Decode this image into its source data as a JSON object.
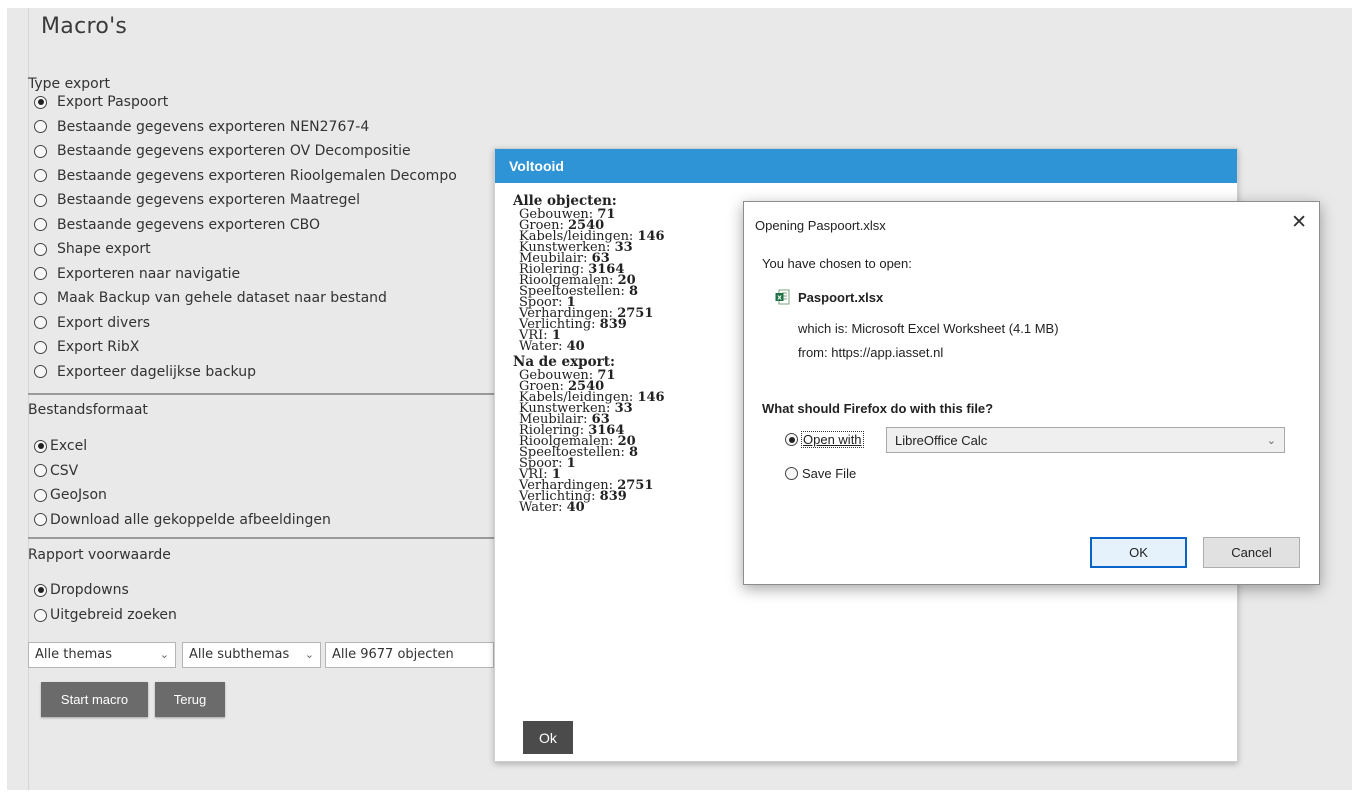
{
  "page": {
    "title": "Macro's"
  },
  "type_export": {
    "label": "Type export",
    "options": [
      {
        "label": "Export Paspoort",
        "checked": true
      },
      {
        "label": "Bestaande gegevens exporteren NEN2767-4",
        "checked": false
      },
      {
        "label": "Bestaande gegevens exporteren OV Decompositie",
        "checked": false
      },
      {
        "label": "Bestaande gegevens exporteren Rioolgemalen Decompo",
        "checked": false
      },
      {
        "label": "Bestaande gegevens exporteren Maatregel",
        "checked": false
      },
      {
        "label": "Bestaande gegevens exporteren CBO",
        "checked": false
      },
      {
        "label": "Shape export",
        "checked": false
      },
      {
        "label": "Exporteren naar navigatie",
        "checked": false
      },
      {
        "label": "Maak Backup van gehele dataset naar bestand",
        "checked": false
      },
      {
        "label": "Export divers",
        "checked": false
      },
      {
        "label": "Export RibX",
        "checked": false
      },
      {
        "label": "Exporteer dagelijkse backup",
        "checked": false
      }
    ]
  },
  "bestandsformaat": {
    "label": "Bestandsformaat",
    "options": [
      {
        "label": "Excel",
        "checked": true
      },
      {
        "label": "CSV",
        "checked": false
      },
      {
        "label": "GeoJson",
        "checked": false
      },
      {
        "label": "Download alle gekoppelde afbeeldingen",
        "checked": false
      }
    ]
  },
  "rapport_voorwaarde": {
    "label": "Rapport voorwaarde",
    "options": [
      {
        "label": "Dropdowns",
        "checked": true
      },
      {
        "label": "Uitgebreid zoeken",
        "checked": false
      }
    ]
  },
  "filters": {
    "themas": "Alle themas",
    "subthemas": "Alle subthemas",
    "objecten": "Alle 9677 objecten"
  },
  "buttons": {
    "start": "Start macro",
    "back": "Terug"
  },
  "modal": {
    "title": "Voltooid",
    "all_title": "Alle objecten:",
    "all_items": [
      {
        "name": "Gebouwen:",
        "value": "71"
      },
      {
        "name": "Groen:",
        "value": "2540"
      },
      {
        "name": "Kabels/leidingen:",
        "value": "146"
      },
      {
        "name": "Kunstwerken:",
        "value": "33"
      },
      {
        "name": "Meubilair:",
        "value": "63"
      },
      {
        "name": "Riolering:",
        "value": "3164"
      },
      {
        "name": "Rioolgemalen:",
        "value": "20"
      },
      {
        "name": "Speeltoestellen:",
        "value": "8"
      },
      {
        "name": "Spoor:",
        "value": "1"
      },
      {
        "name": "Verhardingen:",
        "value": "2751"
      },
      {
        "name": "Verlichting:",
        "value": "839"
      },
      {
        "name": "VRI:",
        "value": "1"
      },
      {
        "name": "Water:",
        "value": "40"
      }
    ],
    "after_title": "Na de export:",
    "after_items": [
      {
        "name": "Gebouwen:",
        "value": "71"
      },
      {
        "name": "Groen:",
        "value": "2540"
      },
      {
        "name": "Kabels/leidingen:",
        "value": "146"
      },
      {
        "name": "Kunstwerken:",
        "value": "33"
      },
      {
        "name": "Meubilair:",
        "value": "63"
      },
      {
        "name": "Riolering:",
        "value": "3164"
      },
      {
        "name": "Rioolgemalen:",
        "value": "20"
      },
      {
        "name": "Speeltoestellen:",
        "value": "8"
      },
      {
        "name": "Spoor:",
        "value": "1"
      },
      {
        "name": "VRI:",
        "value": "1"
      },
      {
        "name": "Verhardingen:",
        "value": "2751"
      },
      {
        "name": "Verlichting:",
        "value": "839"
      },
      {
        "name": "Water:",
        "value": "40"
      }
    ],
    "ok": "Ok"
  },
  "firefox_dialog": {
    "title": "Opening Paspoort.xlsx",
    "chosen": "You have chosen to open:",
    "filename": "Paspoort.xlsx",
    "which_is": "which is: Microsoft Excel Worksheet (4.1 MB)",
    "from": "from: https://app.iasset.nl",
    "question": "What should Firefox do with this file?",
    "open_with_label": "Open with",
    "open_with_app": "LibreOffice Calc",
    "save_file_label": "Save File",
    "ok": "OK",
    "cancel": "Cancel"
  },
  "colors": {
    "header_blue": "#2f94d6",
    "dark_button": "#6b6b6b",
    "focus_blue": "#0a64c7"
  }
}
